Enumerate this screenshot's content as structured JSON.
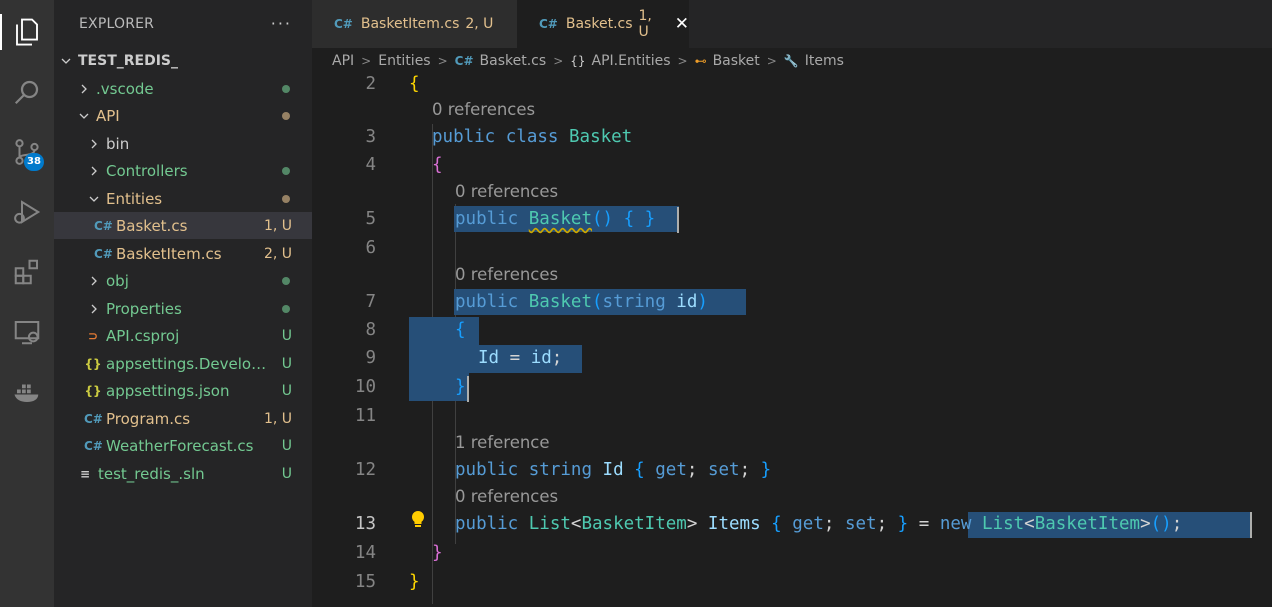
{
  "activity_bar": {
    "items": [
      {
        "name": "explorer",
        "icon": "files-icon"
      },
      {
        "name": "search",
        "icon": "search-icon"
      },
      {
        "name": "source-control",
        "icon": "source-control-icon",
        "badge": "38"
      },
      {
        "name": "run-debug",
        "icon": "debug-icon"
      },
      {
        "name": "extensions",
        "icon": "extensions-icon"
      },
      {
        "name": "remote-explorer",
        "icon": "remote-explorer-icon"
      },
      {
        "name": "docker",
        "icon": "docker-icon"
      }
    ]
  },
  "sidebar": {
    "title": "EXPLORER",
    "more": "···",
    "root": "TEST_REDIS_",
    "tree": [
      {
        "label": ".vscode",
        "status": ""
      },
      {
        "label": "API",
        "status": ""
      },
      {
        "label": "bin",
        "status": ""
      },
      {
        "label": "Controllers",
        "status": ""
      },
      {
        "label": "Entities",
        "status": ""
      },
      {
        "label": "Basket.cs",
        "status": "1, U"
      },
      {
        "label": "BasketItem.cs",
        "status": "2, U"
      },
      {
        "label": "obj",
        "status": ""
      },
      {
        "label": "Properties",
        "status": ""
      },
      {
        "label": "API.csproj",
        "status": "U"
      },
      {
        "label": "appsettings.Develop...",
        "status": "U"
      },
      {
        "label": "appsettings.json",
        "status": "U"
      },
      {
        "label": "Program.cs",
        "status": "1, U"
      },
      {
        "label": "WeatherForecast.cs",
        "status": "U"
      },
      {
        "label": "test_redis_.sln",
        "status": "U"
      }
    ]
  },
  "tabs": [
    {
      "label": "BasketItem.cs",
      "status": "2, U",
      "active": false
    },
    {
      "label": "Basket.cs",
      "status": "1, U",
      "active": true
    }
  ],
  "breadcrumb": [
    "API",
    "Entities",
    "Basket.cs",
    "API.Entities",
    "Basket",
    "Items"
  ],
  "editor": {
    "line_numbers": [
      "2",
      "3",
      "4",
      "5",
      "6",
      "7",
      "8",
      "9",
      "10",
      "11",
      "12",
      "13",
      "14",
      "15"
    ],
    "codelens": [
      "0 references",
      "0 references",
      "0 references",
      "1 reference",
      "0 references"
    ],
    "tokens": {
      "open_brace": "{",
      "close_brace": "}",
      "public": "public",
      "class": "class",
      "basket": "Basket",
      "ctor_empty": "() { }",
      "string": "string",
      "id_param": "id",
      "paren_close": ")",
      "paren_open": "(",
      "id_prop": "Id",
      "assign": "=",
      "semicolon": ";",
      "list": "List",
      "basket_item": "BasketItem",
      "items": "Items",
      "get": "get",
      "set": "set",
      "new": "new",
      "lt": "<",
      "gt": ">",
      "parens": "()"
    }
  },
  "colors": {
    "keyword": "#569cd6",
    "type": "#4ec9b0",
    "identifier": "#9cdcfe",
    "selection": "#264f78",
    "untracked": "#73c991",
    "modified": "#e2c08d"
  }
}
